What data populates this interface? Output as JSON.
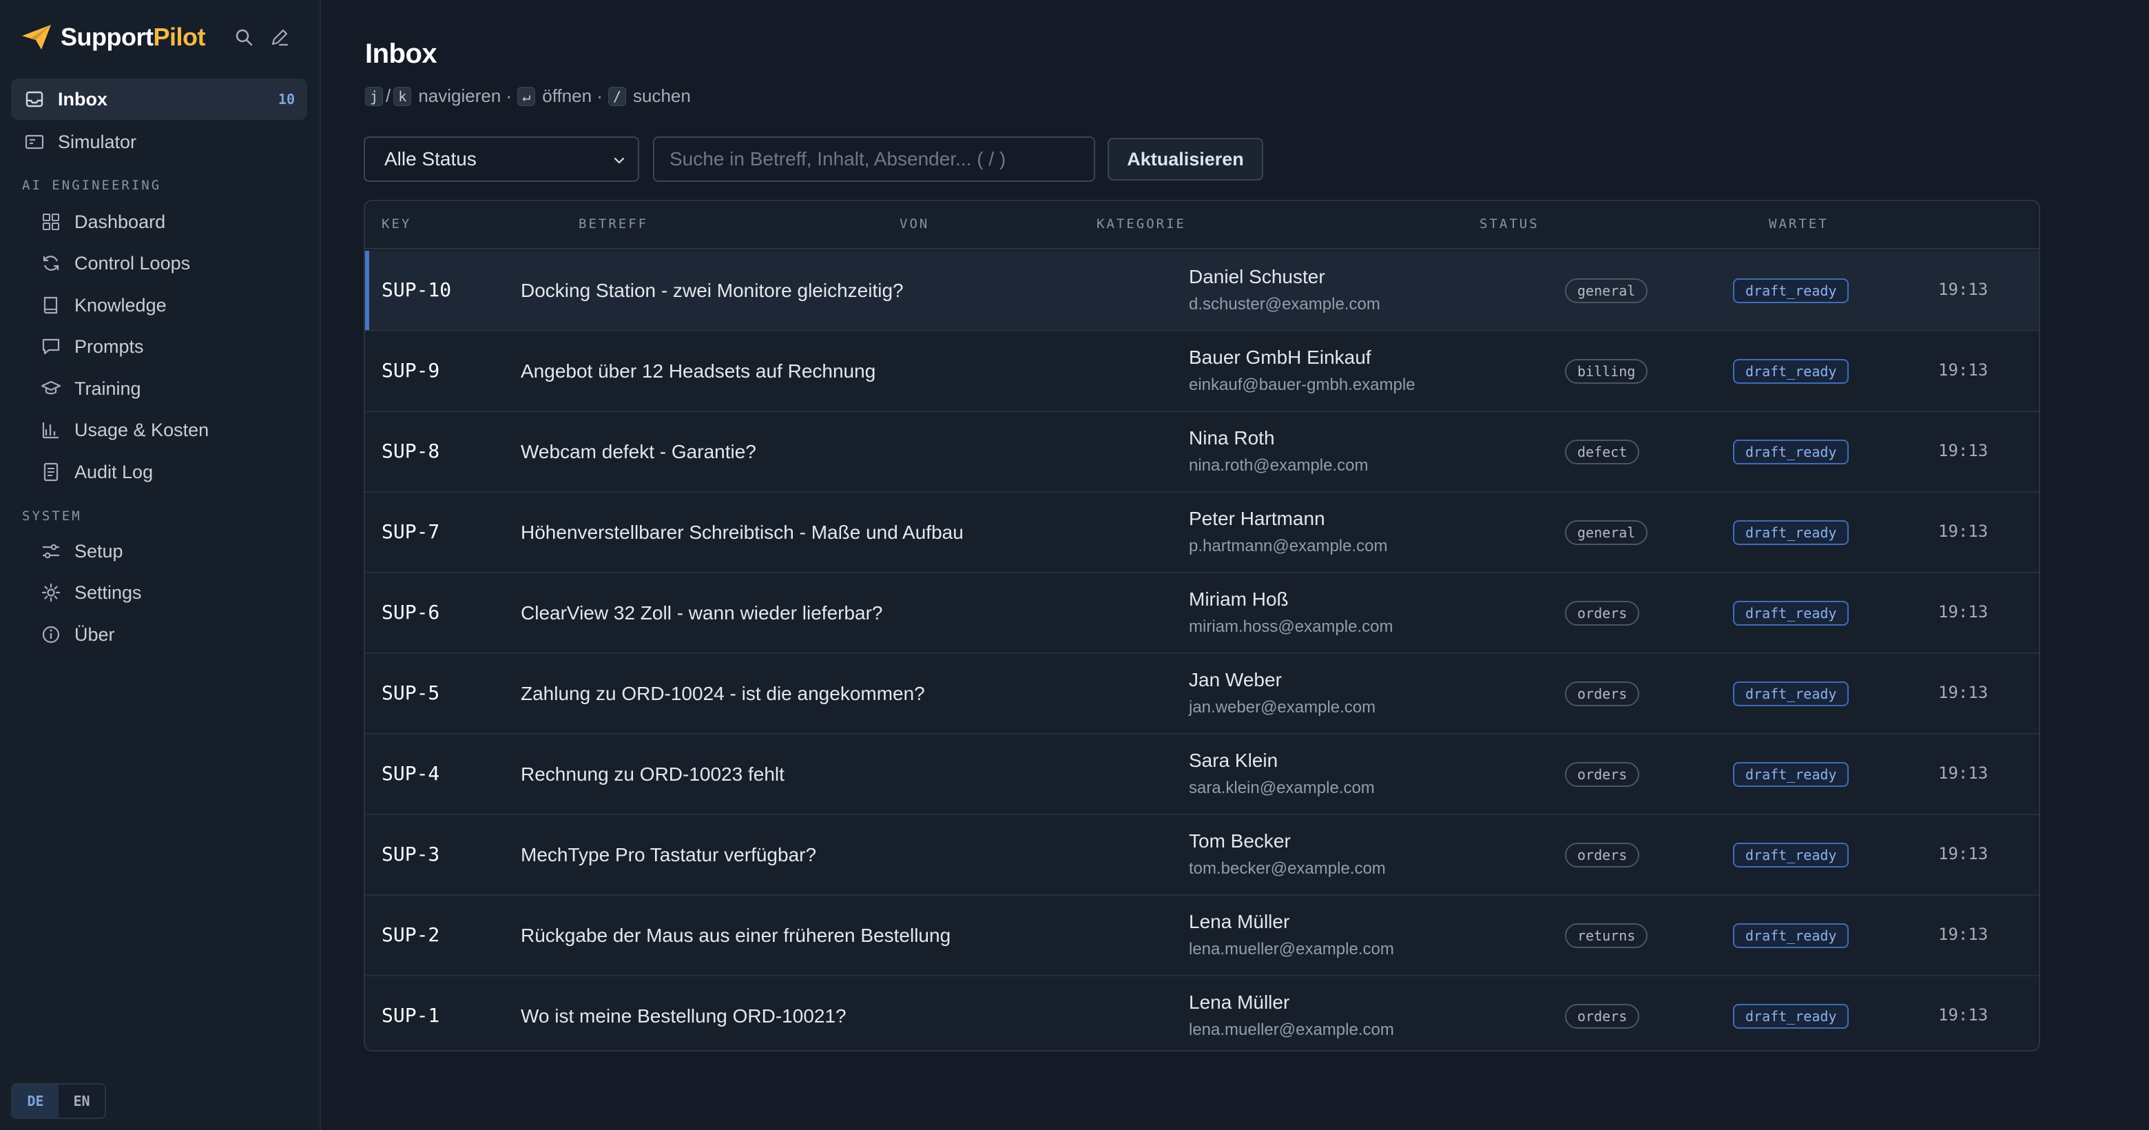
{
  "app": {
    "brand_prefix": "Support",
    "brand_suffix": "Pilot",
    "accent_color": "#f5b942"
  },
  "sidebar": {
    "primary": [
      {
        "label": "Inbox",
        "icon": "inbox-icon",
        "count": "10",
        "active": true
      },
      {
        "label": "Simulator",
        "icon": "simulator-icon"
      }
    ],
    "sections": [
      {
        "label": "AI ENGINEERING",
        "items": [
          {
            "label": "Dashboard",
            "icon": "grid-icon"
          },
          {
            "label": "Control Loops",
            "icon": "refresh-icon"
          },
          {
            "label": "Knowledge",
            "icon": "book-icon"
          },
          {
            "label": "Prompts",
            "icon": "chat-icon"
          },
          {
            "label": "Training",
            "icon": "graduation-cap-icon"
          },
          {
            "label": "Usage & Kosten",
            "icon": "bar-chart-icon"
          },
          {
            "label": "Audit Log",
            "icon": "document-icon"
          }
        ]
      },
      {
        "label": "SYSTEM",
        "items": [
          {
            "label": "Setup",
            "icon": "sliders-icon"
          },
          {
            "label": "Settings",
            "icon": "gear-icon"
          },
          {
            "label": "Über",
            "icon": "info-icon"
          }
        ]
      }
    ],
    "languages": [
      {
        "code": "DE",
        "active": true
      },
      {
        "code": "EN",
        "active": false
      }
    ]
  },
  "main": {
    "title": "Inbox",
    "hints": {
      "key_j": "j",
      "key_k": "k",
      "navigate": "navigieren ·",
      "key_enter": "↵",
      "open": "öffnen ·",
      "key_slash": "/",
      "search": "suchen"
    },
    "filter": {
      "selected": "Alle Status"
    },
    "search": {
      "placeholder": "Suche in Betreff, Inhalt, Absender... ( / )",
      "value": ""
    },
    "refresh_label": "Aktualisieren"
  },
  "table": {
    "columns": [
      "KEY",
      "BETREFF",
      "VON",
      "KATEGORIE",
      "STATUS",
      "WARTET"
    ],
    "rows": [
      {
        "key": "SUP-10",
        "subject": "Docking Station - zwei Monitore gleichzeitig?",
        "name": "Daniel Schuster",
        "email": "d.schuster@example.com",
        "category": "general",
        "status": "draft_ready",
        "time": "19:13",
        "selected": true
      },
      {
        "key": "SUP-9",
        "subject": "Angebot über 12 Headsets auf Rechnung",
        "name": "Bauer GmbH Einkauf",
        "email": "einkauf@bauer-gmbh.example",
        "category": "billing",
        "status": "draft_ready",
        "time": "19:13"
      },
      {
        "key": "SUP-8",
        "subject": "Webcam defekt - Garantie?",
        "name": "Nina Roth",
        "email": "nina.roth@example.com",
        "category": "defect",
        "status": "draft_ready",
        "time": "19:13"
      },
      {
        "key": "SUP-7",
        "subject": "Höhenverstellbarer Schreibtisch - Maße und Aufbau",
        "name": "Peter Hartmann",
        "email": "p.hartmann@example.com",
        "category": "general",
        "status": "draft_ready",
        "time": "19:13"
      },
      {
        "key": "SUP-6",
        "subject": "ClearView 32 Zoll - wann wieder lieferbar?",
        "name": "Miriam Hoß",
        "email": "miriam.hoss@example.com",
        "category": "orders",
        "status": "draft_ready",
        "time": "19:13"
      },
      {
        "key": "SUP-5",
        "subject": "Zahlung zu ORD-10024 - ist die angekommen?",
        "name": "Jan Weber",
        "email": "jan.weber@example.com",
        "category": "orders",
        "status": "draft_ready",
        "time": "19:13"
      },
      {
        "key": "SUP-4",
        "subject": "Rechnung zu ORD-10023 fehlt",
        "name": "Sara Klein",
        "email": "sara.klein@example.com",
        "category": "orders",
        "status": "draft_ready",
        "time": "19:13"
      },
      {
        "key": "SUP-3",
        "subject": "MechType Pro Tastatur verfügbar?",
        "name": "Tom Becker",
        "email": "tom.becker@example.com",
        "category": "orders",
        "status": "draft_ready",
        "time": "19:13"
      },
      {
        "key": "SUP-2",
        "subject": "Rückgabe der Maus aus einer früheren Bestellung",
        "name": "Lena Müller",
        "email": "lena.mueller@example.com",
        "category": "returns",
        "status": "draft_ready",
        "time": "19:13"
      },
      {
        "key": "SUP-1",
        "subject": "Wo ist meine Bestellung ORD-10021?",
        "name": "Lena Müller",
        "email": "lena.mueller@example.com",
        "category": "orders",
        "status": "draft_ready",
        "time": "19:13"
      }
    ]
  }
}
